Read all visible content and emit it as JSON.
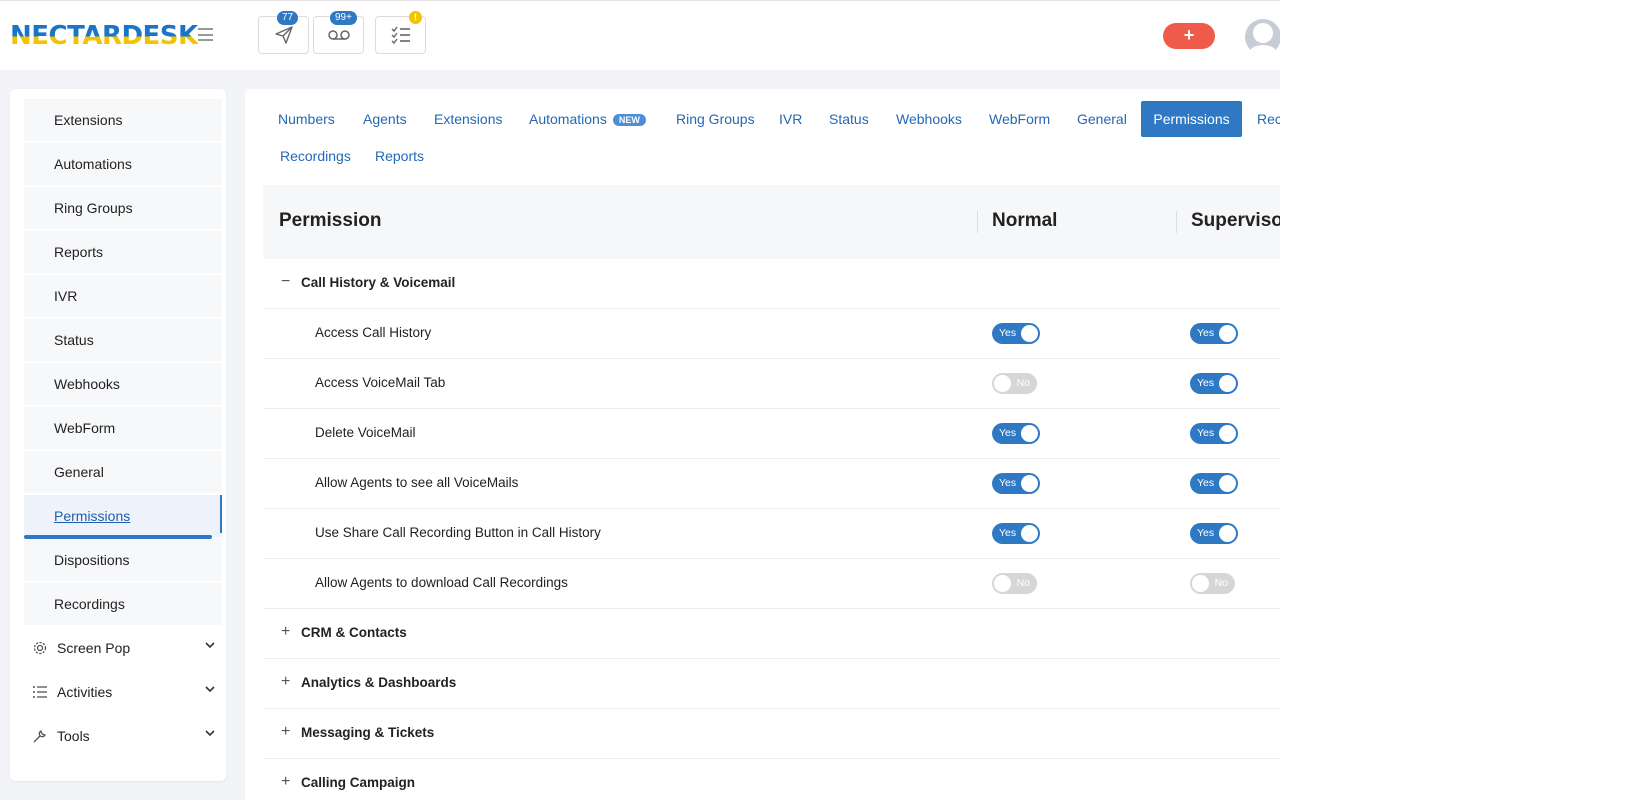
{
  "header": {
    "logo": "NECTARDESK",
    "badges": {
      "outbound": "77",
      "voicemail": "99+",
      "tasks": "!"
    },
    "plus_label": "+"
  },
  "sidebar": {
    "sub_items": [
      {
        "label": "Extensions"
      },
      {
        "label": "Automations"
      },
      {
        "label": "Ring Groups"
      },
      {
        "label": "Reports"
      },
      {
        "label": "IVR"
      },
      {
        "label": "Status"
      },
      {
        "label": "Webhooks"
      },
      {
        "label": "WebForm"
      },
      {
        "label": "General"
      },
      {
        "label": "Permissions"
      },
      {
        "label": "Dispositions"
      },
      {
        "label": "Recordings"
      }
    ],
    "groups": [
      {
        "label": "Screen Pop",
        "icon": "gear-icon"
      },
      {
        "label": "Activities",
        "icon": "list-icon"
      },
      {
        "label": "Tools",
        "icon": "wrench-icon"
      }
    ]
  },
  "tabs": [
    {
      "label": "Numbers"
    },
    {
      "label": "Agents"
    },
    {
      "label": "Extensions"
    },
    {
      "label": "Automations",
      "badge": "NEW"
    },
    {
      "label": "Ring Groups"
    },
    {
      "label": "IVR"
    },
    {
      "label": "Status"
    },
    {
      "label": "Webhooks"
    },
    {
      "label": "WebForm"
    },
    {
      "label": "General"
    },
    {
      "label": "Permissions"
    },
    {
      "label": "Rec"
    },
    {
      "label": "Recordings"
    },
    {
      "label": "Reports"
    }
  ],
  "table": {
    "headers": {
      "permission": "Permission",
      "normal": "Normal",
      "supervisor": "Supervisor"
    },
    "sections": [
      {
        "title": "Call History & Voicemail",
        "expanded": true,
        "sign": "−",
        "rows": [
          {
            "label": "Access Call History",
            "normal": "Yes",
            "supervisor": "Yes"
          },
          {
            "label": "Access VoiceMail Tab",
            "normal": "No",
            "supervisor": "Yes"
          },
          {
            "label": "Delete VoiceMail",
            "normal": "Yes",
            "supervisor": "Yes"
          },
          {
            "label": "Allow Agents to see all VoiceMails",
            "normal": "Yes",
            "supervisor": "Yes"
          },
          {
            "label": "Use Share Call Recording Button in Call History",
            "normal": "Yes",
            "supervisor": "Yes"
          },
          {
            "label": "Allow Agents to download Call Recordings",
            "normal": "No",
            "supervisor": "No"
          }
        ]
      },
      {
        "title": "CRM & Contacts",
        "expanded": false,
        "sign": "+"
      },
      {
        "title": "Analytics & Dashboards",
        "expanded": false,
        "sign": "+"
      },
      {
        "title": "Messaging & Tickets",
        "expanded": false,
        "sign": "+"
      },
      {
        "title": "Calling Campaign",
        "expanded": false,
        "sign": "+"
      }
    ]
  },
  "colors": {
    "accent": "#2f79c4",
    "plus_button": "#ef5a4a",
    "badge_yellow": "#f2c300"
  }
}
